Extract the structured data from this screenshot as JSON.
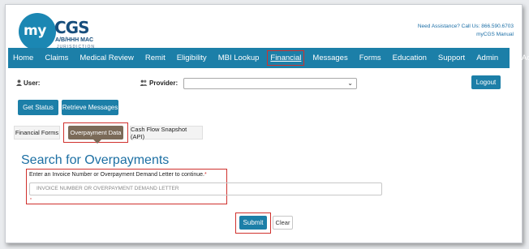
{
  "header": {
    "logo_my": "my",
    "logo_cgs": "CGS",
    "logo_jurisdiction": "A/B/HHH MAC",
    "logo_sub": "JURISDICTION 15",
    "help_line": "Need Assistance? Call Us: 866.590.6703",
    "manual_link": "myCGS Manual"
  },
  "nav": {
    "items": [
      "Home",
      "Claims",
      "Medical Review",
      "Remit",
      "Eligibility",
      "MBI Lookup",
      "Financial",
      "Messages",
      "Forms",
      "Education",
      "Support",
      "Admin",
      "My Account"
    ],
    "active": "Financial"
  },
  "user_label": "User:",
  "provider_label": "Provider:",
  "provider_value": "",
  "logout_label": "Logout",
  "actions": {
    "get_status": "Get Status",
    "retrieve_messages": "Retrieve Messages"
  },
  "tabs": {
    "financial_forms": "Financial Forms",
    "overpayment_data": "Overpayment Data",
    "cash_flow": "Cash Flow Snapshot (API)"
  },
  "search": {
    "title": "Search for Overpayments",
    "label": "Enter an Invoice Number or Overpayment Demand Letter to continue.",
    "required_mark": "*",
    "placeholder": "INVOICE NUMBER OR OVERPAYMENT DEMAND LETTER",
    "small_mark": "*"
  },
  "buttons": {
    "submit": "Submit",
    "clear": "Clear"
  },
  "colors": {
    "nav_bg": "#1c7fa8",
    "highlight": "#d0312d",
    "title": "#1c6fa3",
    "active_tab": "#7b6a58"
  }
}
